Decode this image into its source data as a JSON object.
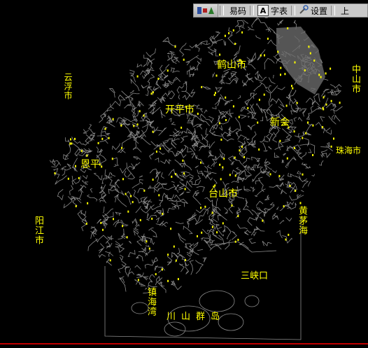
{
  "colors": {
    "background": "#000000",
    "roads": "#8c8c8c",
    "labels": "#ffff00",
    "toolbar": "#c9c9c9",
    "baseline": "#c00000"
  },
  "ime_toolbar": {
    "logo_icon": "ime-logo-icon",
    "items": [
      {
        "label": "易码",
        "icon": "mode-icon"
      },
      {
        "label": "字表",
        "icon": "A-icon"
      },
      {
        "label": "设置",
        "icon": "tools-icon"
      },
      {
        "label": "上",
        "icon": "arrow-icon"
      }
    ]
  },
  "map": {
    "labels": [
      {
        "text": "云浮市",
        "orient": "vertical"
      },
      {
        "text": "阳江市",
        "orient": "vertical"
      },
      {
        "text": "中山市",
        "orient": "vertical"
      },
      {
        "text": "鹤山市",
        "orient": "horizontal"
      },
      {
        "text": "开平市",
        "orient": "horizontal"
      },
      {
        "text": "新会",
        "orient": "horizontal"
      },
      {
        "text": "恩平",
        "orient": "horizontal"
      },
      {
        "text": "台山市",
        "orient": "horizontal"
      },
      {
        "text": "珠海市",
        "orient": "horizontal"
      },
      {
        "text": "黄茅海",
        "orient": "vertical"
      },
      {
        "text": "三峡口",
        "orient": "horizontal"
      },
      {
        "text": "镇海湾",
        "orient": "vertical"
      },
      {
        "text": "川山群岛",
        "orient": "horizontal"
      }
    ]
  }
}
